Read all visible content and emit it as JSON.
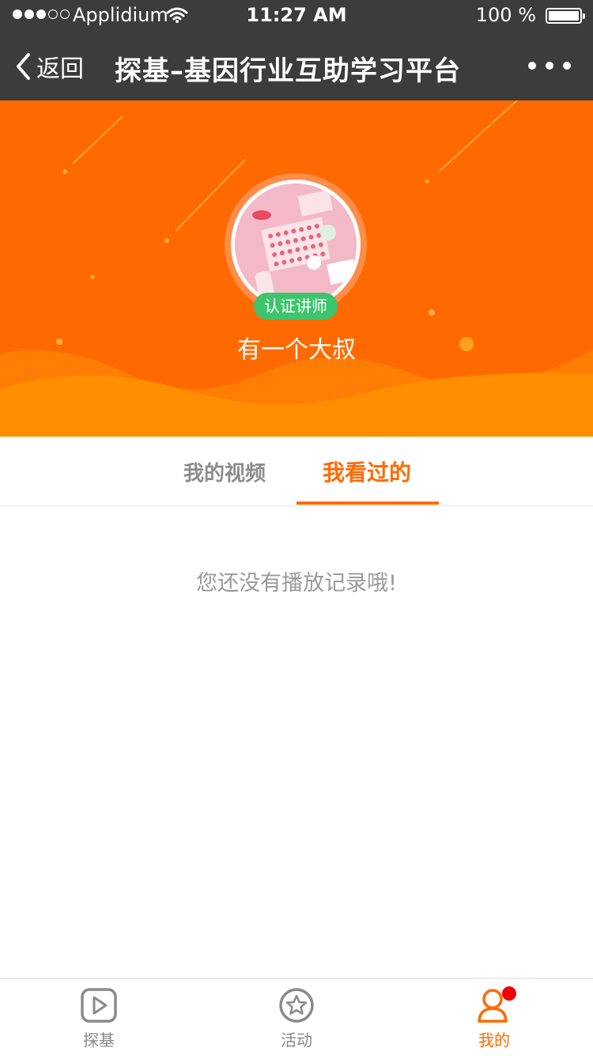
{
  "status_bar": {
    "carrier": "Applidium",
    "time": "11:27 AM",
    "battery_percent": "100 %"
  },
  "nav": {
    "back_label": "返回",
    "title": "探基–基因行业互助学习平台"
  },
  "profile": {
    "badge": "认证讲师",
    "name": "有一个大叔"
  },
  "tabs": [
    {
      "label": "我的视频",
      "active": false
    },
    {
      "label": "我看过的",
      "active": true
    }
  ],
  "empty_message": "您还没有播放记录哦!",
  "tabbar": [
    {
      "label": "探基",
      "icon": "play-icon",
      "active": false
    },
    {
      "label": "活动",
      "icon": "star-icon",
      "active": false
    },
    {
      "label": "我的",
      "icon": "user-icon",
      "active": true,
      "has_notification": true
    }
  ],
  "colors": {
    "accent": "#ff6a00",
    "nav_bg": "#3c3c3c",
    "badge_green": "#3ec46d",
    "notification_red": "#f00000"
  }
}
